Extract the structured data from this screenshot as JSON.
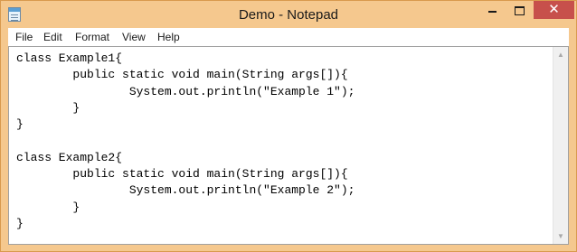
{
  "window": {
    "title": "Demo - Notepad",
    "close_glyph": "✕"
  },
  "menu": [
    "File",
    "Edit",
    "Format",
    "View",
    "Help"
  ],
  "editor": {
    "text": "class Example1{\n        public static void main(String args[]){\n                System.out.println(\"Example 1\");\n        }\n}\n\nclass Example2{\n        public static void main(String args[]){\n                System.out.println(\"Example 2\");\n        }\n}"
  },
  "scrollbar": {
    "up_glyph": "▲",
    "down_glyph": "▼"
  },
  "colors": {
    "frame": "#f5c88e",
    "close_button": "#c7504b"
  },
  "icons": [
    "notepad-app-icon",
    "minimize-icon",
    "maximize-icon",
    "close-icon",
    "scroll-up-icon",
    "scroll-down-icon"
  ]
}
